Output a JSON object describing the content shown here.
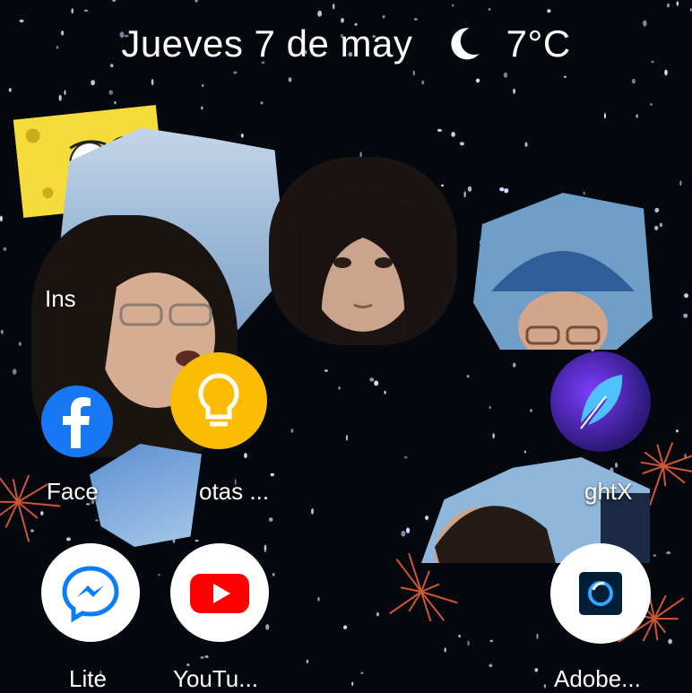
{
  "status": {
    "date": "Jueves 7 de may",
    "weather_icon": "moon-icon",
    "temperature": "7°C"
  },
  "apps": {
    "instagram": {
      "label": "Ins",
      "icon": "instagram-icon"
    },
    "facebook": {
      "label": "Face",
      "icon": "facebook-icon"
    },
    "notas": {
      "label": "otas ...",
      "icon": "lightbulb-icon"
    },
    "lightx": {
      "label": "ghtX",
      "icon": "feather-icon"
    },
    "messenger_lite": {
      "label": "Lite",
      "icon": "messenger-lightning-icon"
    },
    "youtube": {
      "label": "YouTu...",
      "icon": "youtube-play-icon"
    },
    "adobe": {
      "label": "Adobe...",
      "icon": "adobe-photoshop-express-icon"
    }
  },
  "colors": {
    "background": "#05070e",
    "youtube_red": "#ff0000",
    "notas_yellow": "#fbbc04",
    "messenger_blue": "#0a7cff",
    "lightx_purple": "#5b2bd6",
    "facebook_blue": "#1877f2"
  }
}
